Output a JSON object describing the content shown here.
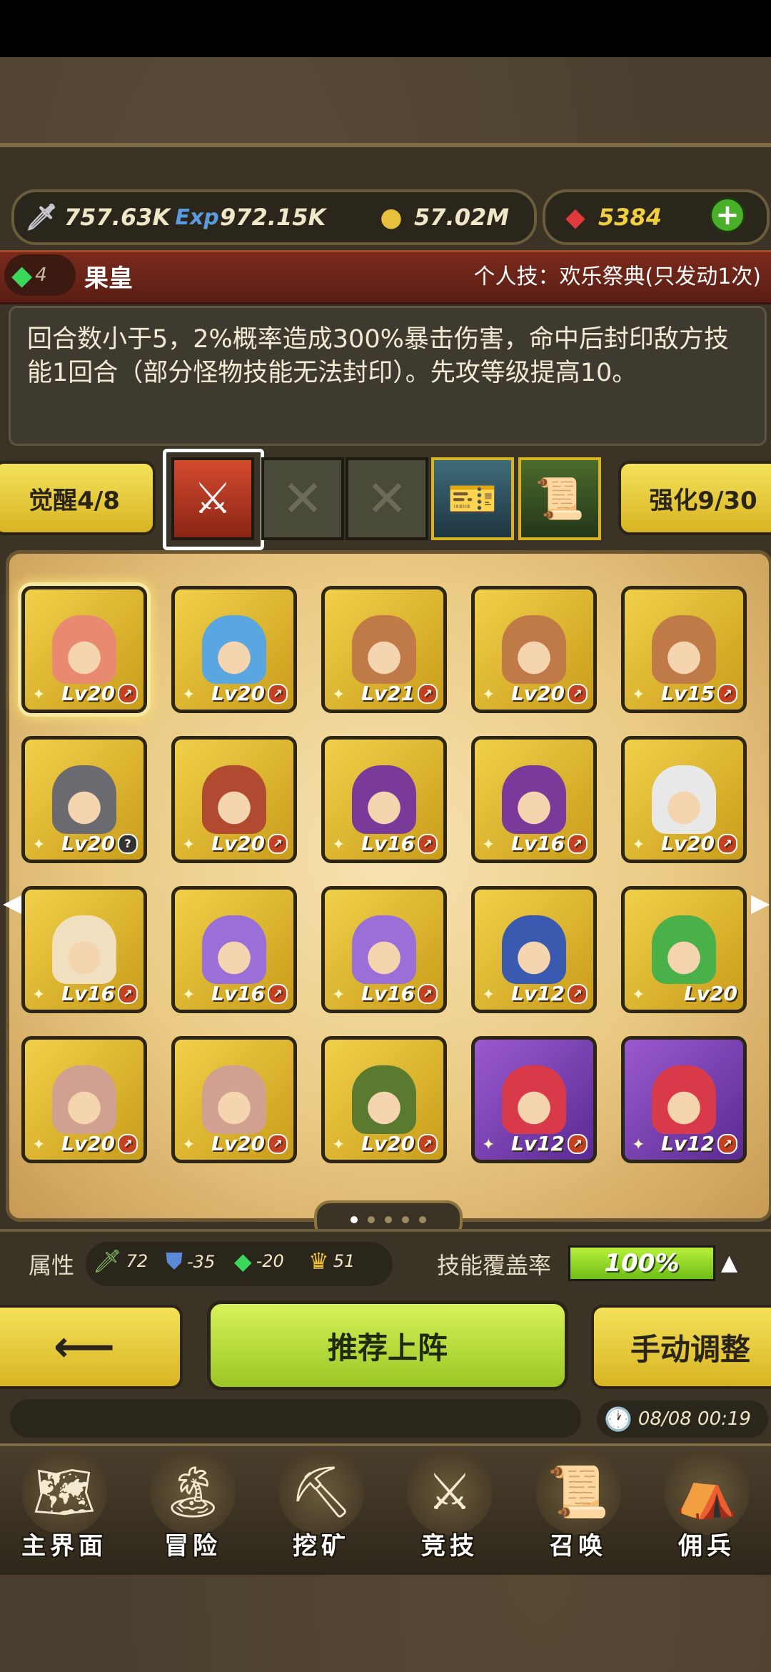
{
  "resources": {
    "sword_value": "757.63K",
    "exp_label": "Exp",
    "exp_value": "972.15K",
    "gold_value": "57.02M",
    "ruby_value": "5384"
  },
  "hero_title": {
    "gem_count": "4",
    "name": "果皇",
    "skill_title": "个人技：欢乐祭典(只发动1次)"
  },
  "description": "回合数小于5，2%概率造成300%暴击伤害，命中后封印敌方技能1回合（部分怪物技能无法封印）。先攻等级提高10。",
  "awaken": {
    "label": "觉醒4/8"
  },
  "enhance": {
    "label": "强化9/30"
  },
  "slot_icons": [
    "blade-icon",
    "x-icon",
    "x-icon",
    "ticket-icon",
    "scroll-icon"
  ],
  "heroes": [
    {
      "lv": "Lv20",
      "color": "#e88a70",
      "frame": "gold",
      "badge": "up",
      "selected": true
    },
    {
      "lv": "Lv20",
      "color": "#5aa6e0",
      "frame": "gold",
      "badge": "up"
    },
    {
      "lv": "Lv21",
      "color": "#c07a48",
      "frame": "gold",
      "badge": "up"
    },
    {
      "lv": "Lv20",
      "color": "#c07a48",
      "frame": "gold",
      "badge": "up"
    },
    {
      "lv": "Lv15",
      "color": "#c07a48",
      "frame": "gold",
      "badge": "up"
    },
    {
      "lv": "Lv20",
      "color": "#6a6a70",
      "frame": "gold",
      "badge": "help"
    },
    {
      "lv": "Lv20",
      "color": "#b04a30",
      "frame": "gold",
      "badge": "up"
    },
    {
      "lv": "Lv16",
      "color": "#7a3a9a",
      "frame": "gold",
      "badge": "up"
    },
    {
      "lv": "Lv16",
      "color": "#7a3a9a",
      "frame": "gold",
      "badge": "up"
    },
    {
      "lv": "Lv20",
      "color": "#e8e8e8",
      "frame": "gold",
      "badge": "up"
    },
    {
      "lv": "Lv16",
      "color": "#f0e0c0",
      "frame": "gold",
      "badge": "up"
    },
    {
      "lv": "Lv16",
      "color": "#9a70d8",
      "frame": "gold",
      "badge": "up"
    },
    {
      "lv": "Lv16",
      "color": "#9a70d8",
      "frame": "gold",
      "badge": "up"
    },
    {
      "lv": "Lv12",
      "color": "#3a5ab0",
      "frame": "gold",
      "badge": "up"
    },
    {
      "lv": "Lv20",
      "color": "#4ab04a",
      "frame": "gold",
      "badge": "none"
    },
    {
      "lv": "Lv20",
      "color": "#d0a090",
      "frame": "gold",
      "badge": "up"
    },
    {
      "lv": "Lv20",
      "color": "#d0a090",
      "frame": "gold",
      "badge": "up"
    },
    {
      "lv": "Lv20",
      "color": "#5a7a30",
      "frame": "gold",
      "badge": "up"
    },
    {
      "lv": "Lv12",
      "color": "#d83a4a",
      "frame": "purple",
      "badge": "up"
    },
    {
      "lv": "Lv12",
      "color": "#d83a4a",
      "frame": "purple",
      "badge": "up"
    }
  ],
  "pager": {
    "pages": 5,
    "current": 1
  },
  "stats": {
    "attr_label": "属性",
    "sword": "72",
    "shield": "-35",
    "gem": "-20",
    "crown": "51",
    "coverage_label": "技能覆盖率",
    "coverage_value": "100%",
    "coverage_fraction": 1.0
  },
  "buttons": {
    "recommend": "推荐上阵",
    "manual": "手动调整"
  },
  "clock": {
    "time": "08/08 00:19"
  },
  "nav": [
    {
      "label": "主界面",
      "icon": "map-scroll-icon",
      "glyph": "🗺"
    },
    {
      "label": "冒险",
      "icon": "island-icon",
      "glyph": "🏝"
    },
    {
      "label": "挖矿",
      "icon": "pickaxe-icon",
      "glyph": "⛏"
    },
    {
      "label": "竞技",
      "icon": "crossed-swords-icon",
      "glyph": "⚔"
    },
    {
      "label": "召唤",
      "icon": "summon-scroll-icon",
      "glyph": "📜"
    },
    {
      "label": "佣兵",
      "icon": "tent-icon",
      "glyph": "⛺"
    }
  ],
  "colors": {
    "gold": "#d8b423",
    "lime": "#9bc624",
    "title_red": "#7b2a1c"
  }
}
